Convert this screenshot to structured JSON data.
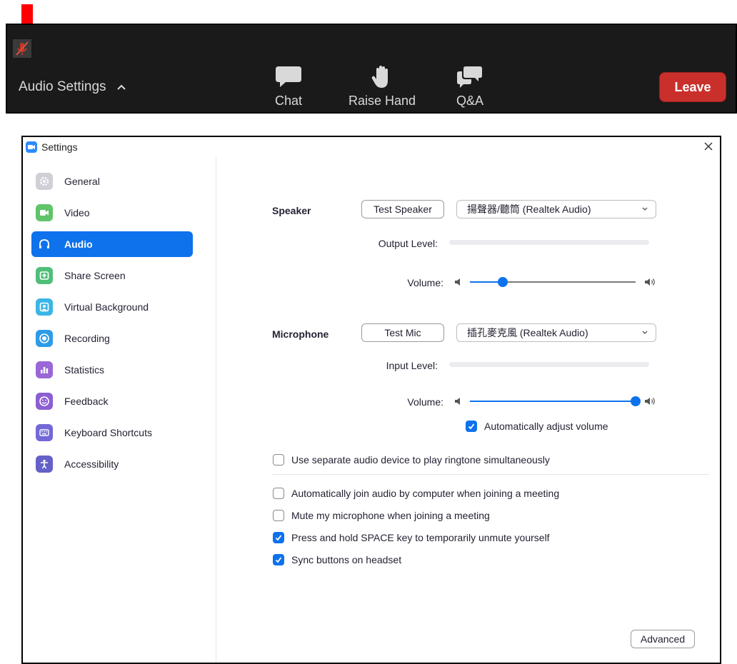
{
  "toolbar": {
    "audio_settings_label": "Audio Settings",
    "chat_label": "Chat",
    "raise_hand_label": "Raise Hand",
    "qa_label": "Q&A",
    "leave_label": "Leave"
  },
  "window": {
    "title": "Settings"
  },
  "sidebar": {
    "items": [
      {
        "label": "General",
        "icon": "gear-icon",
        "color": "#cfcfd6"
      },
      {
        "label": "Video",
        "icon": "video-camera-icon",
        "color": "#5fc46a"
      },
      {
        "label": "Audio",
        "icon": "headphones-icon",
        "color": "#0e72ed",
        "active": true
      },
      {
        "label": "Share Screen",
        "icon": "share-screen-icon",
        "color": "#4fbf78"
      },
      {
        "label": "Virtual Background",
        "icon": "virtual-background-icon",
        "color": "#3ab6e6"
      },
      {
        "label": "Recording",
        "icon": "recording-icon",
        "color": "#2e9be8"
      },
      {
        "label": "Statistics",
        "icon": "statistics-icon",
        "color": "#9a67d6"
      },
      {
        "label": "Feedback",
        "icon": "feedback-icon",
        "color": "#8b5fd2"
      },
      {
        "label": "Keyboard Shortcuts",
        "icon": "keyboard-icon",
        "color": "#7268d8"
      },
      {
        "label": "Accessibility",
        "icon": "accessibility-icon",
        "color": "#6461c9"
      }
    ]
  },
  "speaker": {
    "label": "Speaker",
    "test_label": "Test Speaker",
    "device": "揚聲器/聽筒 (Realtek Audio)",
    "output_level_label": "Output Level:",
    "volume_label": "Volume:",
    "volume": 0.2
  },
  "microphone": {
    "label": "Microphone",
    "test_label": "Test Mic",
    "device": "插孔麥克風 (Realtek Audio)",
    "input_level_label": "Input Level:",
    "volume_label": "Volume:",
    "volume": 1.0,
    "auto_adjust_label": "Automatically adjust volume",
    "auto_adjust": true
  },
  "options": [
    {
      "label": "Use separate audio device to play ringtone simultaneously",
      "checked": false
    },
    {
      "label": "Automatically join audio by computer when joining a meeting",
      "checked": false
    },
    {
      "label": "Mute my microphone when joining a meeting",
      "checked": false
    },
    {
      "label": "Press and hold SPACE key to temporarily unmute yourself",
      "checked": true
    },
    {
      "label": "Sync buttons on headset",
      "checked": true
    }
  ],
  "advanced_label": "Advanced",
  "colors": {
    "accent": "#0e72ed",
    "leave": "#c9302c",
    "toolbar_bg": "#1a1a1a",
    "arrow": "#ff0000"
  }
}
